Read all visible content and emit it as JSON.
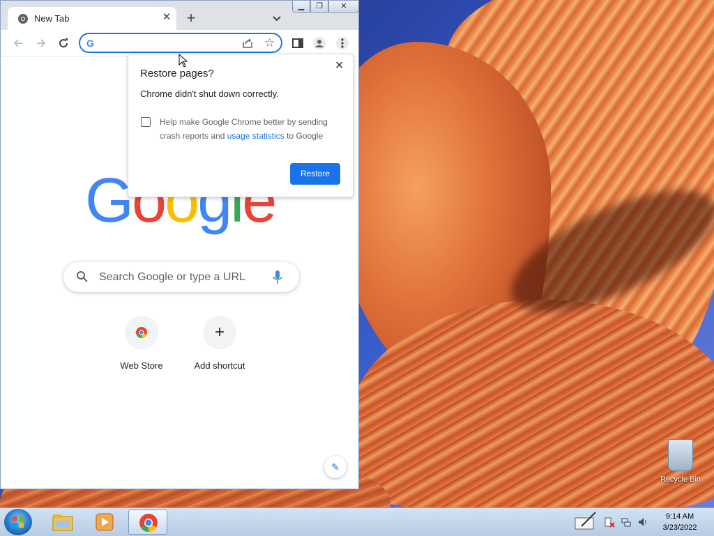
{
  "browser": {
    "tab_title": "New Tab",
    "new_tab_label": "+",
    "window_controls": {
      "minimize": "minimize",
      "maximize": "restore-down",
      "close": "close"
    }
  },
  "toolbar": {
    "back": "back-arrow-icon",
    "forward": "forward-arrow-icon",
    "reload": "reload-icon",
    "omnibox_value": "",
    "omnibox_g": "G"
  },
  "popup": {
    "title": "Restore pages?",
    "body": "Chrome didn't shut down correctly.",
    "help_text_pre": "Help make Google Chrome better by sending crash reports and ",
    "help_link": "usage statistics",
    "help_text_post": " to Google",
    "restore_label": "Restore",
    "checkbox_checked": false
  },
  "ntp": {
    "logo_letters": [
      "G",
      "o",
      "o",
      "g",
      "l",
      "e"
    ],
    "logo_colors": [
      "#4285F4",
      "#EA4335",
      "#FBBC05",
      "#4285F4",
      "#34A853",
      "#EA4335"
    ],
    "search_placeholder": "Search Google or type a URL",
    "shortcuts": [
      {
        "label": "Web Store",
        "icon": "chrome-webstore-icon"
      },
      {
        "label": "Add shortcut",
        "icon": "plus-icon",
        "glyph": "+"
      }
    ]
  },
  "desktop": {
    "recycle_bin_label": "Recycle Bin"
  },
  "taskbar": {
    "time": "9:14 AM",
    "date": "3/23/2022"
  }
}
